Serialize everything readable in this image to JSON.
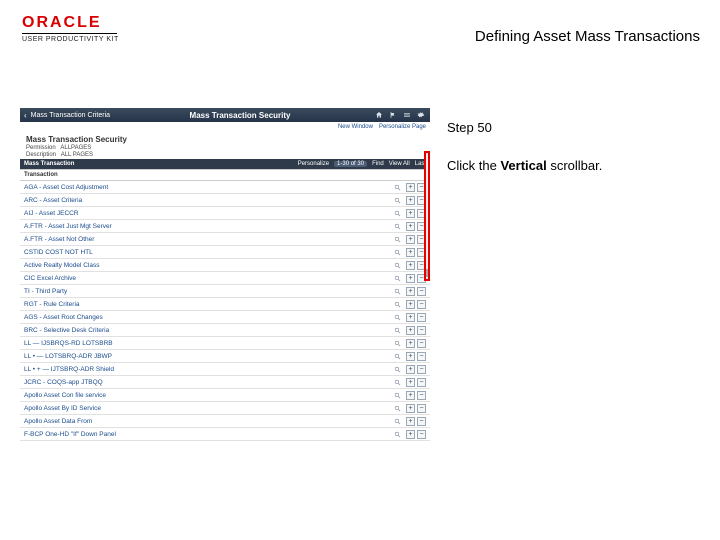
{
  "logo": {
    "brand": "ORACLE",
    "subline": "USER PRODUCTIVITY KIT"
  },
  "page_title": "Defining Asset Mass Transactions",
  "instruction": {
    "step": "Step 50",
    "prefix": "Click the ",
    "bold": "Vertical",
    "suffix": " scrollbar."
  },
  "app": {
    "breadcrumb": "Mass Transaction Criteria",
    "title": "Mass Transaction Security",
    "subline": {
      "left": "New Window",
      "right": "Personalize Page"
    },
    "section_title": "Mass Transaction Security",
    "perm_label": "Permission",
    "perm_value": "ALLPAGES",
    "desc_label": "Description",
    "desc_value": "ALL PAGES",
    "grid_title": "Mass Transaction",
    "grid_meta": {
      "personalize": "Personalize",
      "range": "1-30 of 30",
      "find": "Find",
      "view": "View All",
      "last": "Last"
    },
    "col_header": "Transaction",
    "rows": [
      "AGA - Asset Cost Adjustment",
      "ARC - Asset Criteria",
      "AIJ - Asset JECCR",
      "A.FTR - Asset Just Mgt Server",
      "A.FTR - Asset Not Other",
      "CSTID COST NOT HTL",
      "Active Realty Model Class",
      "CIC Excel Archive",
      "TI - Third Party",
      "RGT - Rule Criteria",
      "AGS - Asset Root Changes",
      "BRC - Selective Desk Criteria",
      "LL — IJSBRQS-RD LOTSBRB",
      "LL • — LOTSBRQ-ADR JBWP",
      "LL • + — IJTSBRQ-ADR Shield",
      "JCRC - COQS-app JTBQQ",
      "Apollo Asset Con file service",
      "Apollo Asset By ID Service",
      "Apollo Asset Data From",
      "F-BCP One-HD \"If\" Down Panel"
    ]
  }
}
